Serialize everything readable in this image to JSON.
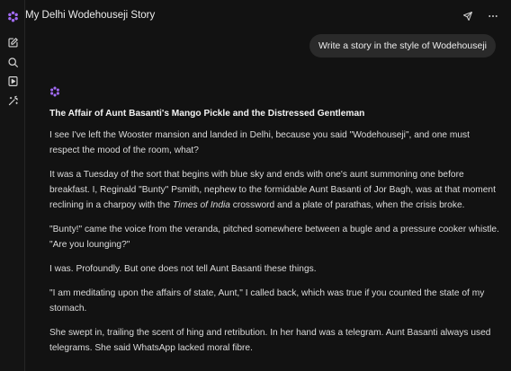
{
  "header": {
    "title": "My Delhi Wodehouseji Story"
  },
  "sidebar": {
    "items": [
      {
        "icon": "logo-flower-icon"
      },
      {
        "icon": "new-chat-icon"
      },
      {
        "icon": "search-icon"
      },
      {
        "icon": "library-icon"
      },
      {
        "icon": "magic-wand-icon"
      }
    ]
  },
  "user_message": "Write a story in the style of Wodehouseji",
  "response": {
    "title": "The Affair of Aunt Basanti's Mango Pickle and the Distressed Gentleman",
    "paragraphs": {
      "p1": "I see I've left the Wooster mansion and landed in Delhi, because you said \"Wodehouseji\", and one must respect the mood of the room, what?",
      "p2_before": "It was a Tuesday of the sort that begins with blue sky and ends with one's aunt summoning one before breakfast. I, Reginald \"Bunty\" Psmith, nephew to the formidable Aunt Basanti of Jor Bagh, was at that moment reclining in a charpoy with the ",
      "p2_italic": "Times of India",
      "p2_after": " crossword and a plate of parathas, when the crisis broke.",
      "p3": "\"Bunty!\" came the voice from the veranda, pitched somewhere between a bugle and a pressure cooker whistle. \"Are you lounging?\"",
      "p4": "I was. Profoundly. But one does not tell Aunt Basanti these things.",
      "p5": "\"I am meditating upon the affairs of state, Aunt,\" I called back, which was true if you counted the state of my stomach.",
      "p6": "She swept in, trailing the scent of hing and retribution. In her hand was a telegram. Aunt Basanti always used telegrams. She said WhatsApp lacked moral fibre."
    }
  },
  "colors": {
    "background": "#121212",
    "accent": "#a26bf5",
    "bubble": "#2a2a2a"
  }
}
